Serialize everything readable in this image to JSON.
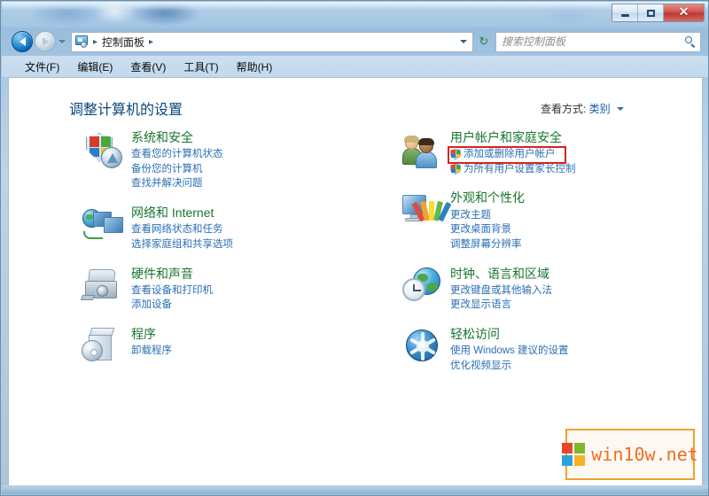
{
  "window": {
    "caption_buttons": {
      "minimize": "–",
      "maximize": "☐",
      "close": "✕"
    }
  },
  "addressbar": {
    "back_tooltip": "后退",
    "forward_tooltip": "前进",
    "breadcrumb": [
      {
        "label": "控制面板",
        "separator": "▸"
      }
    ],
    "leading_separator": "▸",
    "refresh": "↻"
  },
  "search": {
    "placeholder": "搜索控制面板",
    "value": ""
  },
  "menubar": {
    "items": [
      {
        "label": "文件(F)"
      },
      {
        "label": "编辑(E)"
      },
      {
        "label": "查看(V)"
      },
      {
        "label": "工具(T)"
      },
      {
        "label": "帮助(H)"
      }
    ]
  },
  "main": {
    "page_title": "调整计算机的设置",
    "view_by_label": "查看方式:",
    "view_by_value": "类别"
  },
  "categories": {
    "left": [
      {
        "icon": "system-security-icon",
        "title": "系统和安全",
        "links": [
          {
            "label": "查看您的计算机状态",
            "shield": false
          },
          {
            "label": "备份您的计算机",
            "shield": false
          },
          {
            "label": "查找并解决问题",
            "shield": false
          }
        ]
      },
      {
        "icon": "network-internet-icon",
        "title": "网络和 Internet",
        "links": [
          {
            "label": "查看网络状态和任务",
            "shield": false
          },
          {
            "label": "选择家庭组和共享选项",
            "shield": false
          }
        ]
      },
      {
        "icon": "hardware-sound-icon",
        "title": "硬件和声音",
        "links": [
          {
            "label": "查看设备和打印机",
            "shield": false
          },
          {
            "label": "添加设备",
            "shield": false
          }
        ]
      },
      {
        "icon": "programs-icon",
        "title": "程序",
        "links": [
          {
            "label": "卸载程序",
            "shield": false
          }
        ]
      }
    ],
    "right": [
      {
        "icon": "user-accounts-family-safety-icon",
        "title": "用户帐户和家庭安全",
        "links": [
          {
            "label": "添加或删除用户帐户",
            "shield": true,
            "highlighted": true
          },
          {
            "label": "为所有用户设置家长控制",
            "shield": true,
            "highlighted": false
          }
        ]
      },
      {
        "icon": "appearance-personalization-icon",
        "title": "外观和个性化",
        "links": [
          {
            "label": "更改主题",
            "shield": false
          },
          {
            "label": "更改桌面背景",
            "shield": false
          },
          {
            "label": "调整屏幕分辨率",
            "shield": false
          }
        ]
      },
      {
        "icon": "clock-language-region-icon",
        "title": "时钟、语言和区域",
        "links": [
          {
            "label": "更改键盘或其他输入法",
            "shield": false
          },
          {
            "label": "更改显示语言",
            "shield": false
          }
        ]
      },
      {
        "icon": "ease-of-access-icon",
        "title": "轻松访问",
        "links": [
          {
            "label": "使用 Windows 建议的设置",
            "shield": false
          },
          {
            "label": "优化视频显示",
            "shield": false
          }
        ]
      }
    ]
  },
  "watermark": {
    "text": "win10w.net"
  },
  "colors": {
    "category_title": "#18752f",
    "link": "#2b6fb5",
    "page_title": "#0b4778",
    "highlight_box": "#e02020",
    "watermark_text": "#ef6c22",
    "watermark_border": "#f0a030"
  }
}
